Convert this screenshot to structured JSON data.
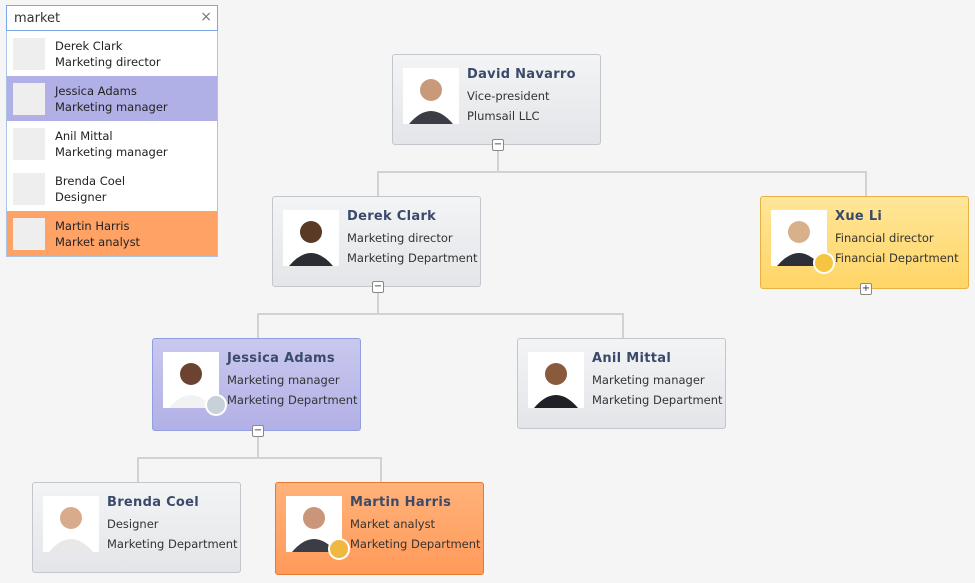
{
  "search": {
    "value": "market",
    "clear_icon": "×"
  },
  "results": [
    {
      "name": "Derek Clark",
      "title": "Marketing director",
      "highlight": ""
    },
    {
      "name": "Jessica Adams",
      "title": "Marketing manager",
      "highlight": "#b0afe6"
    },
    {
      "name": "Anil Mittal",
      "title": "Marketing manager",
      "highlight": ""
    },
    {
      "name": "Brenda Coel",
      "title": "Designer",
      "highlight": ""
    },
    {
      "name": "Martin Harris",
      "title": "Market analyst",
      "highlight": "#ffa266"
    }
  ],
  "nodes": {
    "david": {
      "name": "David Navarro",
      "title": "Vice-president",
      "dept": "Plumsail LLC",
      "toggle": "−"
    },
    "derek": {
      "name": "Derek Clark",
      "title": "Marketing director",
      "dept": "Marketing Department",
      "toggle": "−"
    },
    "xue": {
      "name": "Xue Li",
      "title": "Financial director",
      "dept": "Financial Department",
      "toggle": "+"
    },
    "jessica": {
      "name": "Jessica Adams",
      "title": "Marketing manager",
      "dept": "Marketing Department",
      "toggle": "−"
    },
    "anil": {
      "name": "Anil Mittal",
      "title": "Marketing manager",
      "dept": "Marketing Department"
    },
    "brenda": {
      "name": "Brenda Coel",
      "title": "Designer",
      "dept": "Marketing Department"
    },
    "martin": {
      "name": "Martin Harris",
      "title": "Market analyst",
      "dept": "Marketing Department"
    }
  }
}
